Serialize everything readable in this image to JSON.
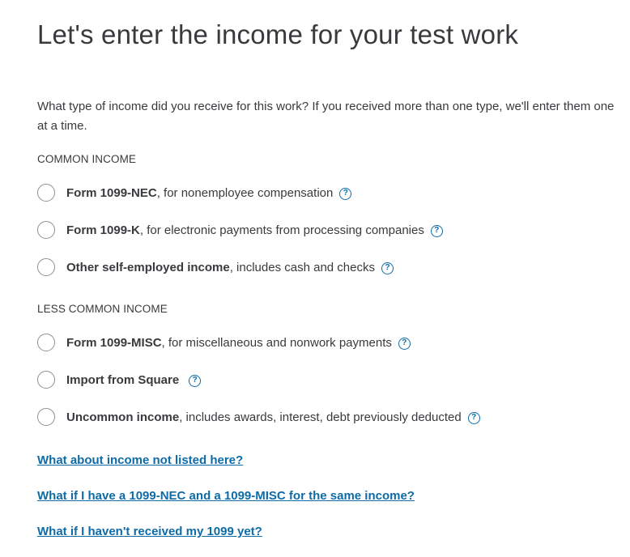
{
  "page": {
    "title": "Let's enter the income for your test work",
    "intro": "What type of income did you receive for this work? If you received more than one type, we'll enter them one at a time."
  },
  "sections": [
    {
      "label": "COMMON INCOME",
      "options": [
        {
          "bold": "Form 1099-NEC",
          "rest": ", for nonemployee compensation"
        },
        {
          "bold": "Form 1099-K",
          "rest": ", for electronic payments from processing companies"
        },
        {
          "bold": "Other self-employed income",
          "rest": ", includes cash and checks"
        }
      ]
    },
    {
      "label": "LESS COMMON INCOME",
      "options": [
        {
          "bold": "Form 1099-MISC",
          "rest": ", for miscellaneous and nonwork payments"
        },
        {
          "bold": "Import from Square",
          "rest": ""
        },
        {
          "bold": "Uncommon income",
          "rest": ", includes awards, interest, debt previously deducted"
        }
      ]
    }
  ],
  "help_icon": {
    "glyph": "?",
    "icon": "question-circle-icon",
    "color": "#0d6ba8"
  },
  "links": [
    "What about income not listed here?",
    "What if I have a 1099-NEC and a 1099-MISC for the same income?",
    "What if I haven't received my 1099 yet?"
  ],
  "colors": {
    "text": "#393a3d",
    "link": "#0d6ba8",
    "radio_border": "#8d9096"
  }
}
